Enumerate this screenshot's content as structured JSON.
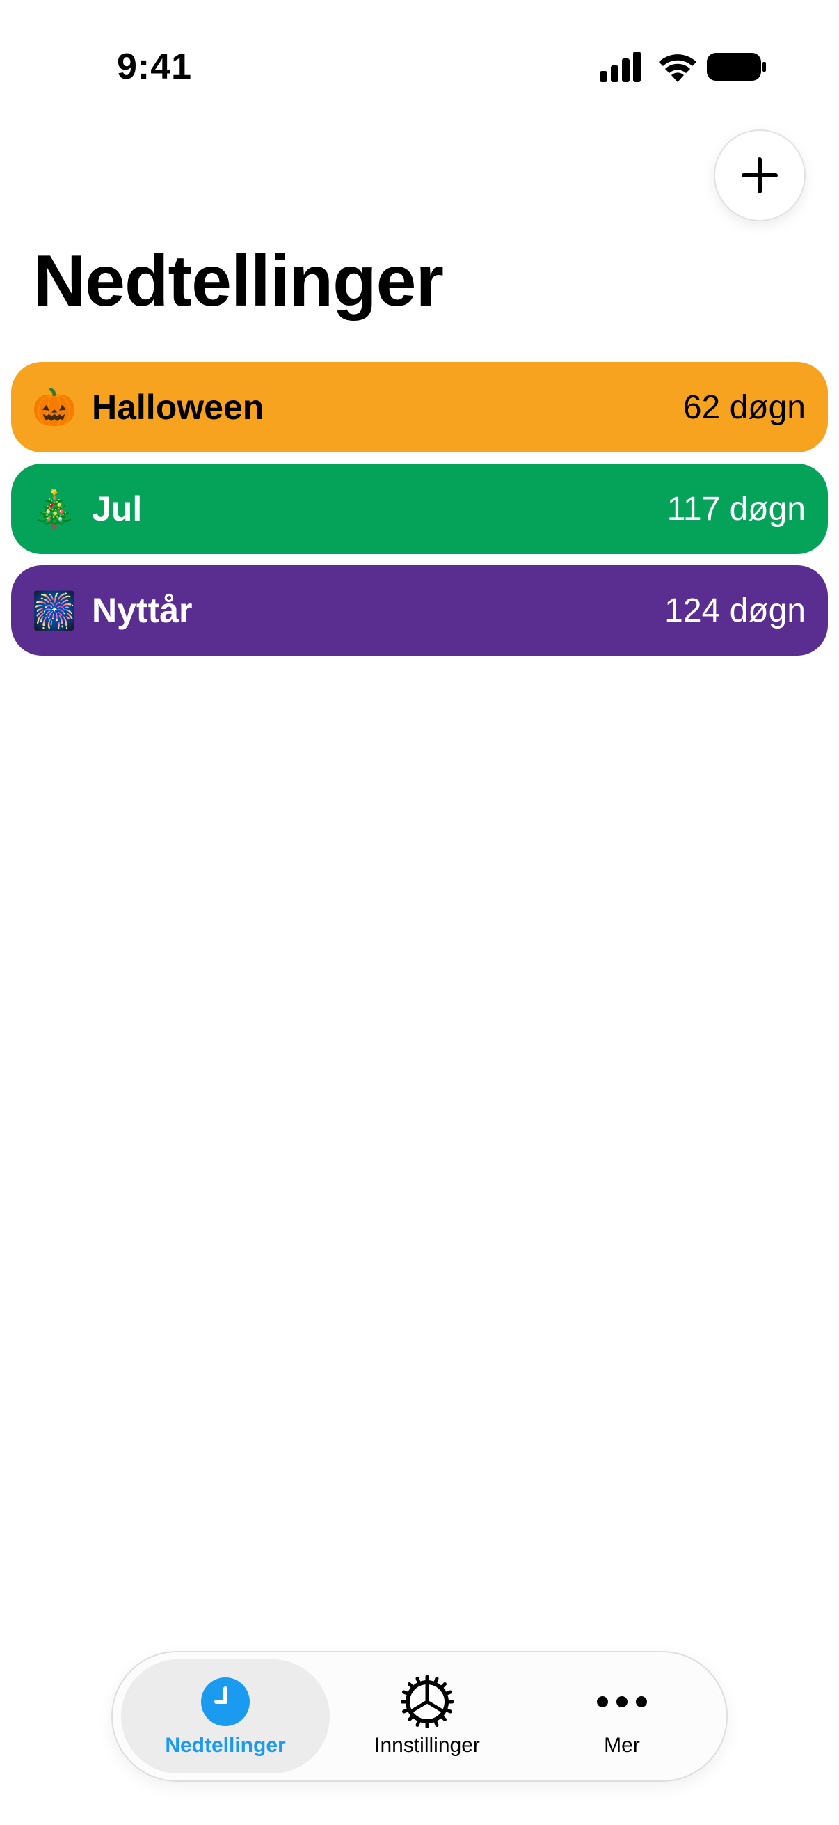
{
  "status_bar": {
    "time": "9:41"
  },
  "header": {
    "add_icon": "plus-icon",
    "title": "Nedtellinger"
  },
  "countdowns": [
    {
      "emoji": "🎃",
      "emoji_icon": "pumpkin-icon",
      "name": "Halloween",
      "days": "62 døgn",
      "color": "#F8A31F",
      "text_color": "#000000"
    },
    {
      "emoji": "🎄",
      "emoji_icon": "christmas-tree-icon",
      "name": "Jul",
      "days": "117 døgn",
      "color": "#05A35A",
      "text_color": "#FFFFFF"
    },
    {
      "emoji": "🎆",
      "emoji_icon": "fireworks-icon",
      "name": "Nyttår",
      "days": "124 døgn",
      "color": "#5A2E91",
      "text_color": "#FFFFFF"
    }
  ],
  "tab_bar": {
    "active_color": "#1A9BF0",
    "tabs": [
      {
        "label": "Nedtellinger",
        "icon": "clock-icon",
        "active": true
      },
      {
        "label": "Innstillinger",
        "icon": "gear-icon",
        "active": false
      },
      {
        "label": "Mer",
        "icon": "more-icon",
        "active": false
      }
    ]
  }
}
